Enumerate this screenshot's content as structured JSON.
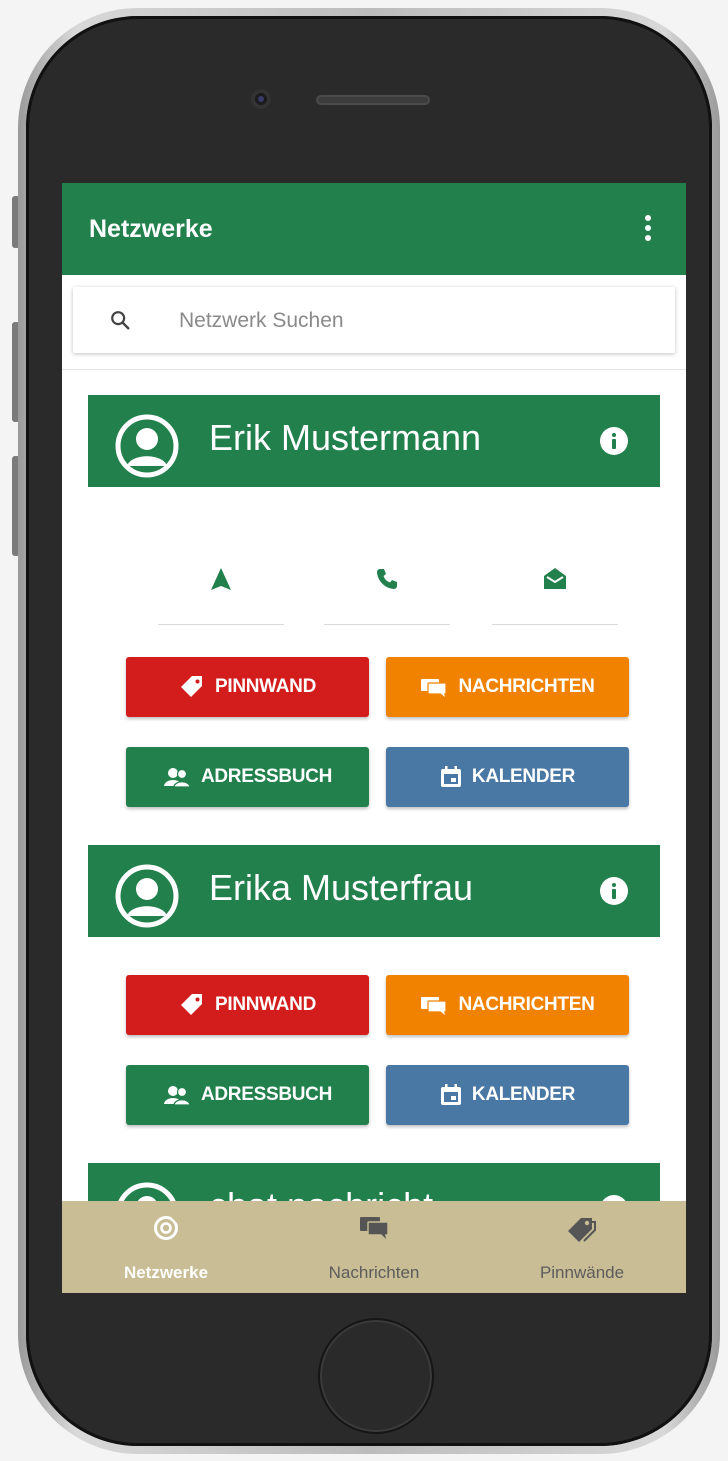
{
  "appbar": {
    "title": "Netzwerke"
  },
  "search": {
    "placeholder": "Netzwerk Suchen"
  },
  "networks": [
    {
      "name": "Erik Mustermann",
      "buttons": {
        "pinnwand": "PINNWAND",
        "nachrichten": "NACHRICHTEN",
        "adressbuch": "ADRESSBUCH",
        "kalender": "KALENDER"
      }
    },
    {
      "name": "Erika Musterfrau",
      "buttons": {
        "pinnwand": "PINNWAND",
        "nachrichten": "NACHRICHTEN",
        "adressbuch": "ADRESSBUCH",
        "kalender": "KALENDER"
      }
    },
    {
      "name": "chat nachricht"
    }
  ],
  "bottom_nav": [
    {
      "label": "Netzwerke",
      "icon": "target-icon",
      "active": true
    },
    {
      "label": "Nachrichten",
      "icon": "chat-icon",
      "active": false
    },
    {
      "label": "Pinnwände",
      "icon": "tag-icon",
      "active": false
    }
  ],
  "colors": {
    "primary": "#22804d",
    "pinnwand": "#d31c1c",
    "nachrichten": "#f08200",
    "adressbuch": "#22804d",
    "kalender": "#4a78a4",
    "bottom_nav_bg": "#c8bd94"
  }
}
